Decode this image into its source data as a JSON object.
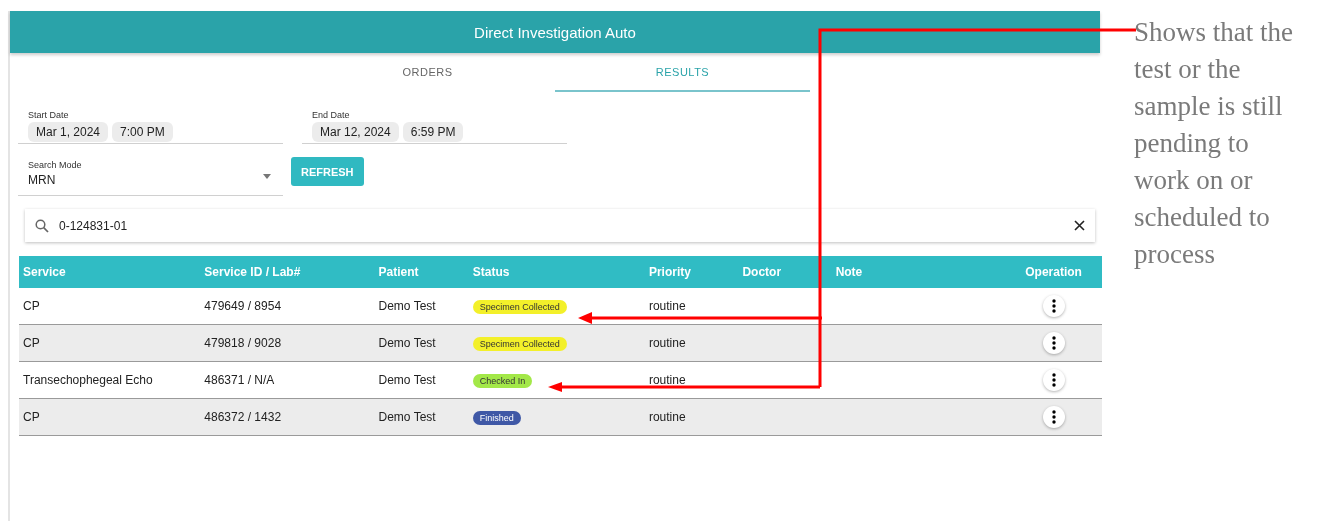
{
  "window": {
    "title": "Direct Investigation Auto"
  },
  "tabs": [
    {
      "label": "ORDERS",
      "selected": false
    },
    {
      "label": "RESULTS",
      "selected": true
    }
  ],
  "start_date": {
    "label": "Start Date",
    "date": "Mar 1, 2024",
    "time": "7:00 PM"
  },
  "end_date": {
    "label": "End Date",
    "date": "Mar 12, 2024",
    "time": "6:59 PM"
  },
  "search_mode": {
    "label": "Search Mode",
    "value": "MRN"
  },
  "refresh_button": "REFRESH",
  "search": {
    "value": "0-124831-01"
  },
  "table": {
    "columns": [
      "Service",
      "Service ID / Lab#",
      "Patient",
      "Status",
      "Priority",
      "Doctor",
      "Note",
      "Operation"
    ],
    "rows": [
      {
        "service": "CP",
        "service_id": "479649 / 8954",
        "patient": "Demo Test",
        "status": {
          "label": "Specimen Collected",
          "color": "#f3f02a"
        },
        "priority": "routine"
      },
      {
        "service": "CP",
        "service_id": "479818 / 9028",
        "patient": "Demo Test",
        "status": {
          "label": "Specimen Collected",
          "color": "#f3f02a"
        },
        "priority": "routine"
      },
      {
        "service": "Transechophegeal Echo",
        "service_id": "486371 / N/A",
        "patient": "Demo Test",
        "status": {
          "label": "Checked In",
          "color": "#a3e848"
        },
        "priority": "routine"
      },
      {
        "service": "CP",
        "service_id": "486372 / 1432",
        "patient": "Demo Test",
        "status": {
          "label": "Finished",
          "color": "#3f58a6"
        },
        "priority": "routine"
      }
    ]
  },
  "annotation": {
    "text": "Shows that the test or the sample is still pending to work on or scheduled to process"
  }
}
